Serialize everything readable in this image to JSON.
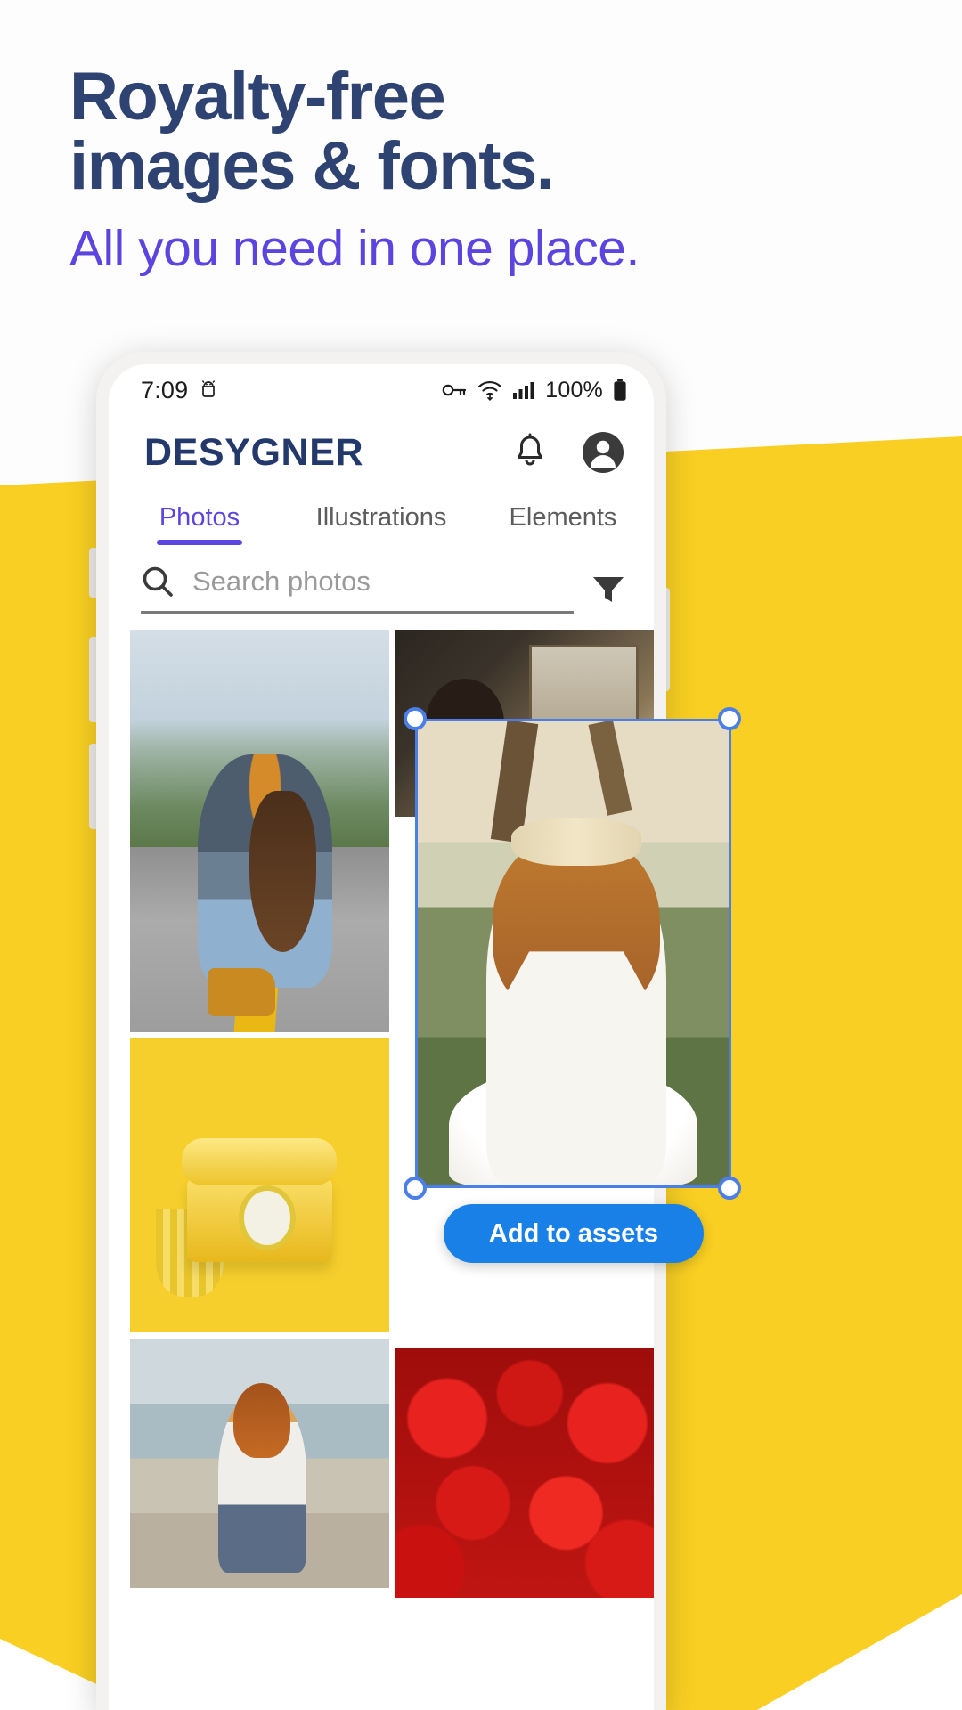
{
  "hero": {
    "title_line1": "Royalty-free",
    "title_line2": "images & fonts.",
    "subtitle": "All you need in one place.",
    "title_color": "#2e4372",
    "subtitle_color": "#5b44e0"
  },
  "theme": {
    "brand_yellow": "#f9cf23",
    "accent_purple": "#5b44e0",
    "navy": "#23386b",
    "selection_blue": "#4a7ee8",
    "button_blue": "#1980e8"
  },
  "phone": {
    "statusbar": {
      "time": "7:09",
      "android_icon": "android-robot-icon",
      "vpn_icon": "vpn-key-icon",
      "wifi_icon": "wifi-icon",
      "signal_icon": "cellular-signal-icon",
      "battery_percent": "100%",
      "battery_icon": "battery-full-icon"
    },
    "header": {
      "logo": "DESYGNER",
      "notification_icon": "bell-icon",
      "account_icon": "account-circle-icon"
    },
    "tabs": [
      {
        "label": "Photos",
        "active": true
      },
      {
        "label": "Illustrations",
        "active": false
      },
      {
        "label": "Elements",
        "active": false
      }
    ],
    "search": {
      "placeholder": "Search photos",
      "value": "",
      "search_icon": "search-icon",
      "filter_icon": "filter-funnel-icon"
    },
    "gallery": {
      "left_column": [
        {
          "name": "photographer-on-road-photo"
        },
        {
          "name": "yellow-rotary-phone-photo"
        },
        {
          "name": "woman-on-beach-photo"
        }
      ],
      "right_column": [
        {
          "name": "woman-at-desk-photo"
        },
        {
          "name": "strawberries-photo"
        }
      ],
      "selected_photo": {
        "name": "bride-with-dandelion-photo"
      }
    },
    "selection": {
      "handles": [
        "top-left",
        "top-right",
        "bottom-left",
        "bottom-right"
      ]
    },
    "add_to_assets_label": "Add to assets"
  }
}
